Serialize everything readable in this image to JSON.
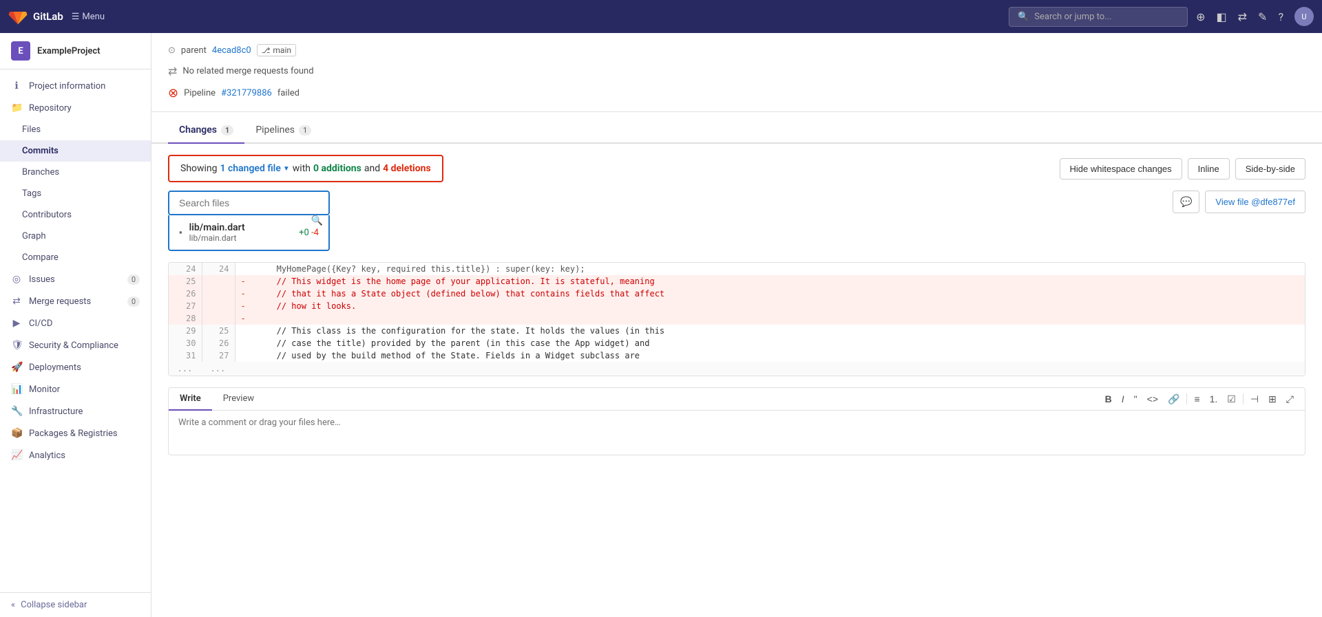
{
  "topnav": {
    "brand": "GitLab",
    "menu_label": "Menu",
    "search_placeholder": "Search or jump to...",
    "icons": [
      "+",
      "▣",
      "⇄",
      "✎",
      "?",
      "●"
    ]
  },
  "sidebar": {
    "project_initial": "E",
    "project_name": "ExampleProject",
    "items": [
      {
        "id": "project-information",
        "label": "Project information",
        "icon": "ℹ",
        "sub": false
      },
      {
        "id": "repository",
        "label": "Repository",
        "icon": "📁",
        "sub": false
      },
      {
        "id": "files",
        "label": "Files",
        "icon": "",
        "sub": true
      },
      {
        "id": "commits",
        "label": "Commits",
        "icon": "",
        "sub": true,
        "active": true
      },
      {
        "id": "branches",
        "label": "Branches",
        "icon": "",
        "sub": true
      },
      {
        "id": "tags",
        "label": "Tags",
        "icon": "",
        "sub": true
      },
      {
        "id": "contributors",
        "label": "Contributors",
        "icon": "",
        "sub": true
      },
      {
        "id": "graph",
        "label": "Graph",
        "icon": "",
        "sub": true
      },
      {
        "id": "compare",
        "label": "Compare",
        "icon": "",
        "sub": true
      },
      {
        "id": "issues",
        "label": "Issues",
        "icon": "◎",
        "sub": false,
        "badge": "0"
      },
      {
        "id": "merge-requests",
        "label": "Merge requests",
        "icon": "⇄",
        "sub": false,
        "badge": "0"
      },
      {
        "id": "cicd",
        "label": "CI/CD",
        "icon": "▶",
        "sub": false
      },
      {
        "id": "security-compliance",
        "label": "Security & Compliance",
        "icon": "🛡",
        "sub": false
      },
      {
        "id": "deployments",
        "label": "Deployments",
        "icon": "🚀",
        "sub": false
      },
      {
        "id": "monitor",
        "label": "Monitor",
        "icon": "📊",
        "sub": false
      },
      {
        "id": "infrastructure",
        "label": "Infrastructure",
        "icon": "🔧",
        "sub": false
      },
      {
        "id": "packages-registries",
        "label": "Packages & Registries",
        "icon": "📦",
        "sub": false
      },
      {
        "id": "analytics",
        "label": "Analytics",
        "icon": "📈",
        "sub": false
      }
    ],
    "collapse_label": "Collapse sidebar"
  },
  "commit": {
    "parent_label": "parent",
    "parent_hash": "4ecad8c0",
    "branch_name": "main",
    "no_mr_text": "No related merge requests found",
    "pipeline_label": "Pipeline",
    "pipeline_number": "#321779886",
    "pipeline_status": "failed"
  },
  "tabs": [
    {
      "id": "changes",
      "label": "Changes",
      "count": "1",
      "active": true
    },
    {
      "id": "pipelines",
      "label": "Pipelines",
      "count": "1",
      "active": false
    }
  ],
  "changes": {
    "summary": {
      "prefix": "Showing",
      "file_count": "1 changed file",
      "with_text": "with",
      "additions": "0 additions",
      "and_text": "and",
      "deletions": "4 deletions"
    },
    "buttons": {
      "hide_whitespace": "Hide whitespace changes",
      "inline": "Inline",
      "side_by_side": "Side-by-side",
      "view_file": "View file @dfe877ef"
    },
    "search_placeholder": "Search files",
    "file": {
      "name": "lib/main.dart",
      "path": "lib/main.dart",
      "additions": "+0",
      "deletions": "-4"
    }
  },
  "diff": {
    "rows": [
      {
        "left_num": "24",
        "right_num": "24",
        "type": "context",
        "sign": "",
        "content": "    MyHomePage({Key? key, required this.title}) : super(key: key);"
      },
      {
        "left_num": "25",
        "right_num": "",
        "type": "del",
        "sign": "-",
        "content": "    // This widget is the home page of your application. It is stateful, meaning"
      },
      {
        "left_num": "26",
        "right_num": "",
        "type": "del",
        "sign": "-",
        "content": "    // that it has a State object (defined below) that contains fields that affect"
      },
      {
        "left_num": "27",
        "right_num": "",
        "type": "del",
        "sign": "-",
        "content": "    // how it looks."
      },
      {
        "left_num": "28",
        "right_num": "",
        "type": "del",
        "sign": "-",
        "content": ""
      },
      {
        "left_num": "29",
        "right_num": "25",
        "type": "context",
        "sign": "",
        "content": "    // This class is the configuration for the state. It holds the values (in this"
      },
      {
        "left_num": "30",
        "right_num": "26",
        "type": "context",
        "sign": "",
        "content": "    // case the title) provided by the parent (in this case the App widget) and"
      },
      {
        "left_num": "31",
        "right_num": "27",
        "type": "context",
        "sign": "",
        "content": "    // used by the build method of the State. Fields in a Widget subclass are"
      },
      {
        "left_num": "...",
        "right_num": "...",
        "type": "ellipsis",
        "sign": "",
        "content": "..."
      }
    ]
  },
  "comment": {
    "write_tab": "Write",
    "preview_tab": "Preview",
    "placeholder": "Write a comment or drag your files here…",
    "toolbar_buttons": [
      "B",
      "I",
      "\"",
      "<>",
      "🔗",
      "≡",
      "1.",
      "☑",
      "◫",
      "⊞",
      "⤢"
    ]
  }
}
